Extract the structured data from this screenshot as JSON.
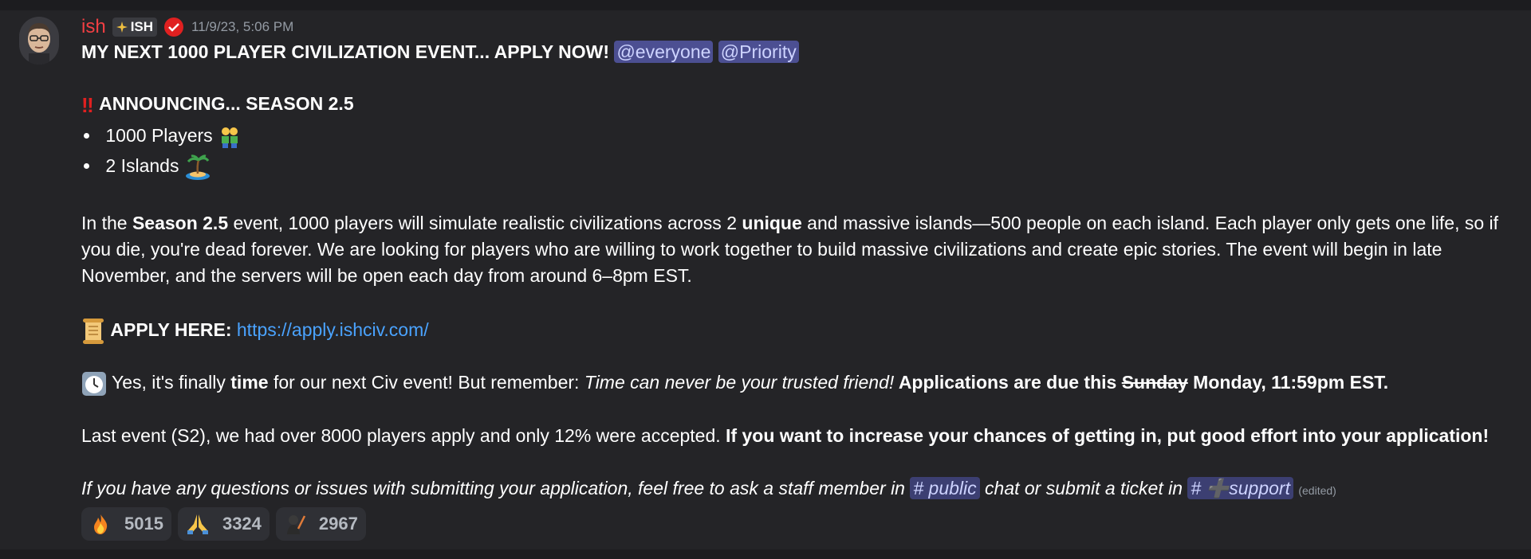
{
  "message": {
    "author": "ish",
    "tag": "ISH",
    "timestamp": "11/9/23, 5:06 PM",
    "headline": "MY NEXT 1000 PLAYER CIVILIZATION EVENT... APPLY NOW!",
    "mentions": [
      "@everyone",
      "@Priority"
    ],
    "announce": "ANNOUNCING... SEASON 2.5",
    "bullets": [
      "1000 Players",
      "2 Islands"
    ],
    "para1": {
      "p1": "In the ",
      "b1": "Season 2.5",
      "p2": " event, 1000 players will simulate realistic civilizations across 2 ",
      "b2": "unique",
      "p3": " and massive islands—500 people on each island. Each player only gets one life, so if you die, you're dead forever. We are looking for players who are willing to work together to build massive civilizations and create epic stories. The event will begin in late November, and the servers will be open each day from around 6–8pm EST."
    },
    "apply_label": "APPLY HERE:",
    "apply_link": "https://apply.ishciv.com/",
    "time_line": {
      "p1": " Yes, it's finally ",
      "b1": "time",
      "p2": " for our next Civ event! But remember: ",
      "i1": "Time can never be your trusted friend!",
      "b2": " Applications are due this ",
      "strike": "Sunday",
      "b3": " Monday, 11:59pm EST."
    },
    "last_event": {
      "p1": "Last event (S2), we had over 8000 players apply and only 12% were accepted. ",
      "b1": "If you want to increase your chances of getting in, put good effort into your application!"
    },
    "questions": {
      "i1": "If you have any questions or issues with submitting your application, feel free to ask a staff member in ",
      "channel1": "# public",
      "i2": " chat or submit a ticket in ",
      "channel2": "# ➕support",
      "edited": "(edited)"
    },
    "reactions": [
      {
        "emoji": "fire-emoji",
        "count": "5015"
      },
      {
        "emoji": "folded-hands-emoji",
        "count": "3324"
      },
      {
        "emoji": "custom-emoji",
        "count": "2967"
      }
    ]
  },
  "colors": {
    "background": "#242427",
    "username": "#f23f43",
    "mention_bg": "#4c4f92",
    "link": "#4aa3ff"
  }
}
